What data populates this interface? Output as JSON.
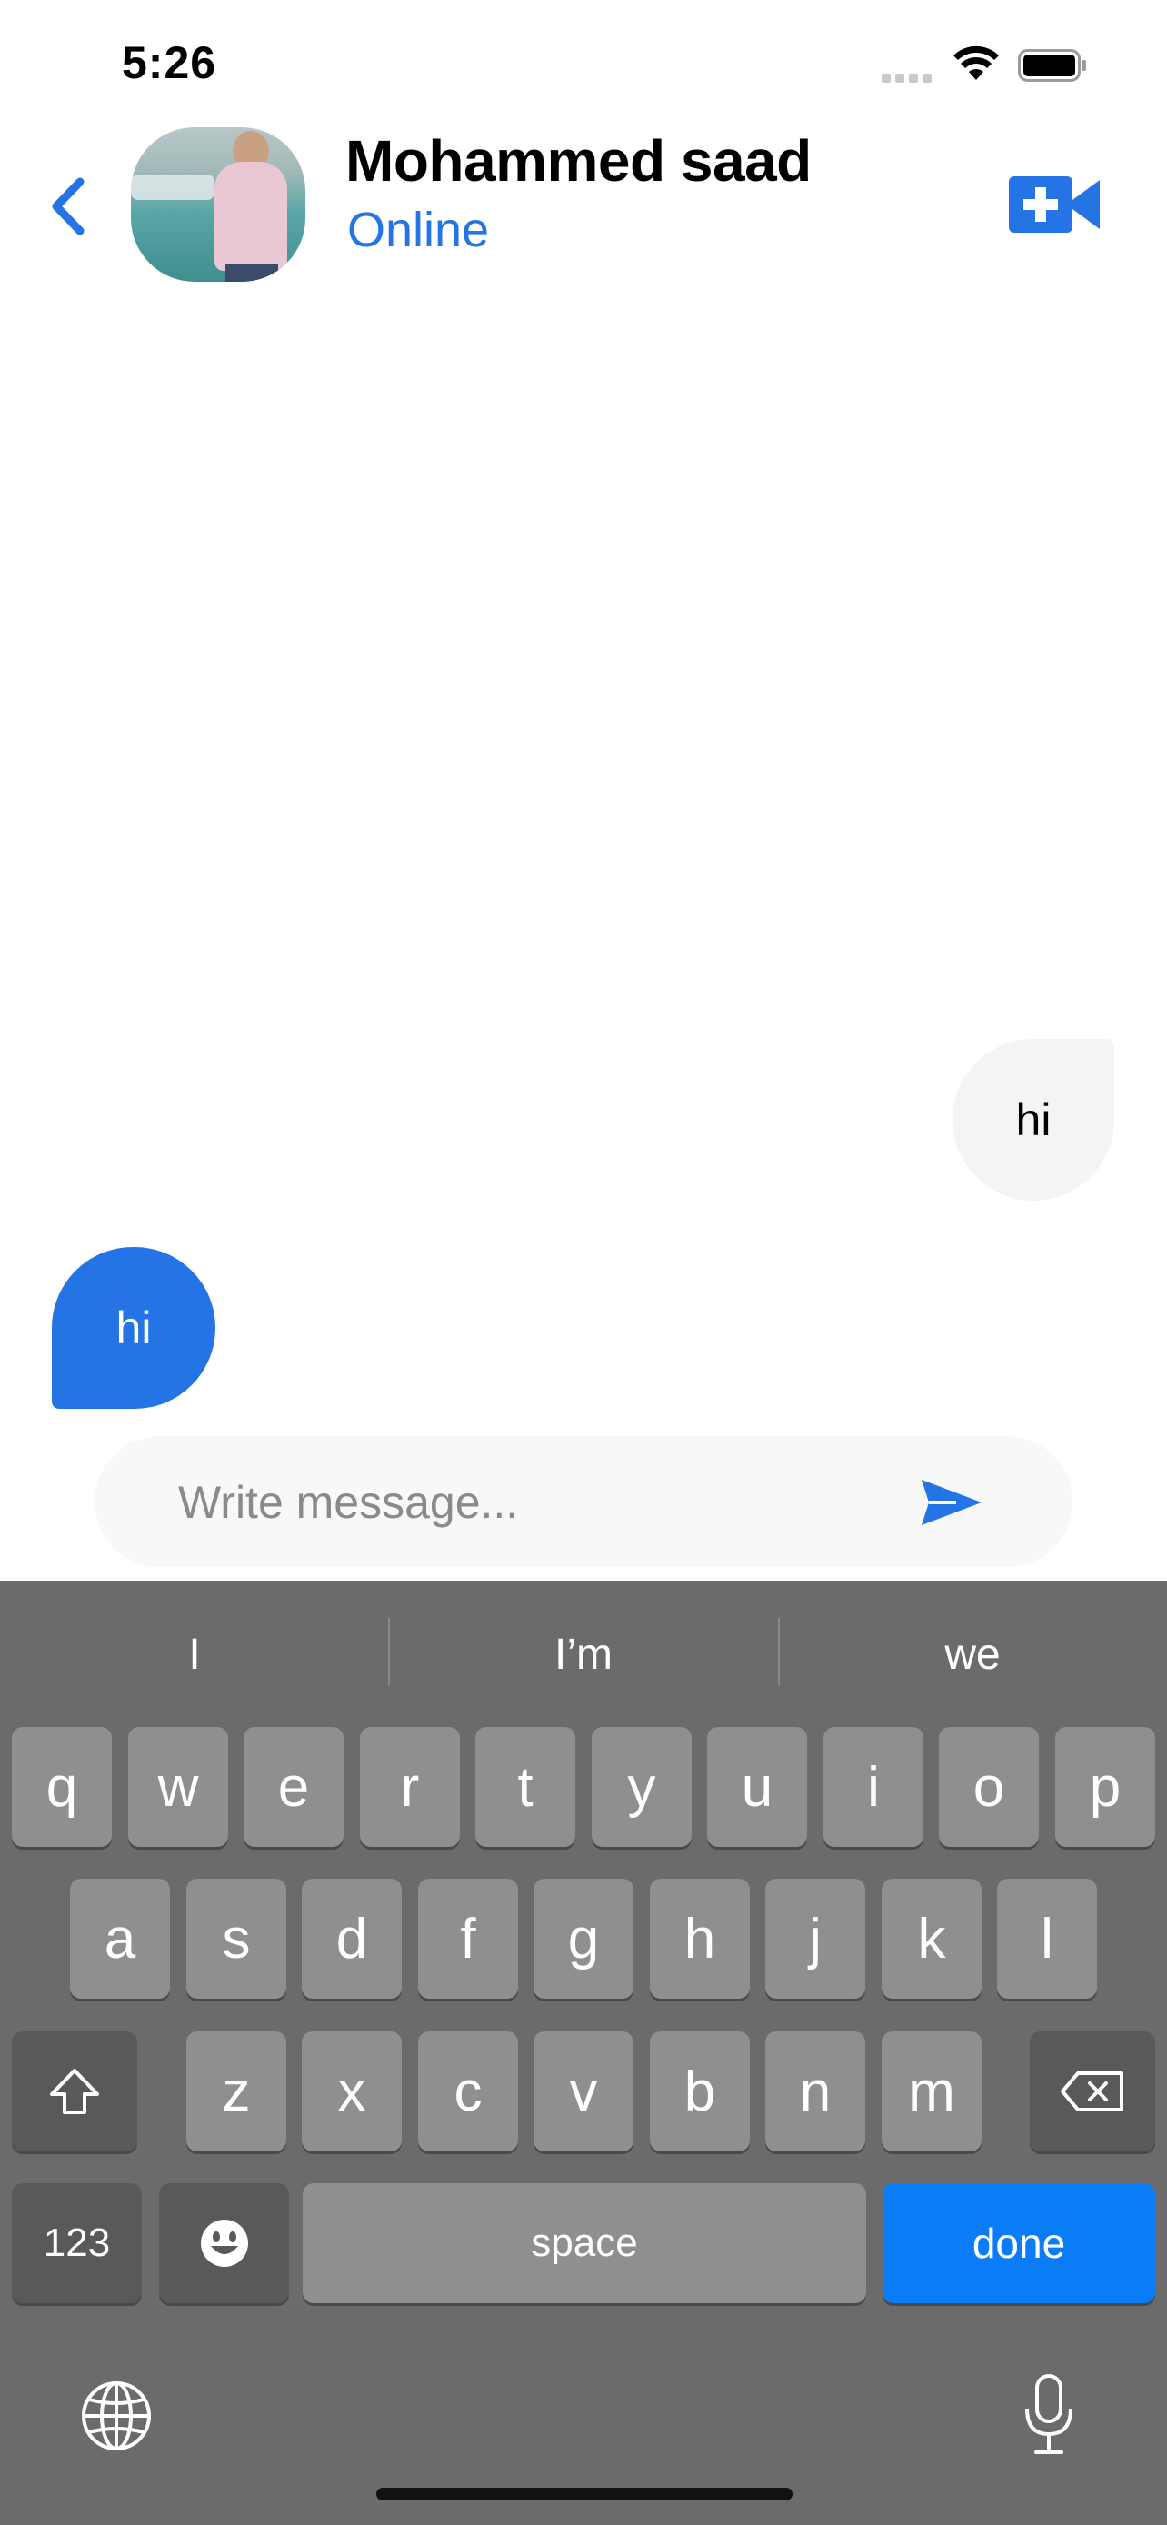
{
  "status_bar": {
    "time": "5:26"
  },
  "header": {
    "name": "Mohammed saad",
    "status": "Online"
  },
  "messages": [
    {
      "side": "received",
      "text": "hi"
    },
    {
      "side": "sent",
      "text": "hi"
    }
  ],
  "composer": {
    "placeholder": "Write message...",
    "value": ""
  },
  "keyboard": {
    "suggestions": [
      "I",
      "I’m",
      "we"
    ],
    "row1": [
      "q",
      "w",
      "e",
      "r",
      "t",
      "y",
      "u",
      "i",
      "o",
      "p"
    ],
    "row2": [
      "a",
      "s",
      "d",
      "f",
      "g",
      "h",
      "j",
      "k",
      "l"
    ],
    "row3": [
      "z",
      "x",
      "c",
      "v",
      "b",
      "n",
      "m"
    ],
    "numbers_label": "123",
    "space_label": "space",
    "done_label": "done"
  },
  "colors": {
    "accent": "#2474e5",
    "incoming_bubble": "#f4f4f4",
    "keyboard_bg": "#6b6b6b",
    "done_key": "#0a7cf8"
  },
  "icons": [
    "back-chevron-icon",
    "video-call-icon",
    "send-icon",
    "shift-icon",
    "backspace-icon",
    "emoji-icon",
    "globe-icon",
    "microphone-icon",
    "wifi-icon",
    "battery-icon",
    "signal-icon"
  ]
}
